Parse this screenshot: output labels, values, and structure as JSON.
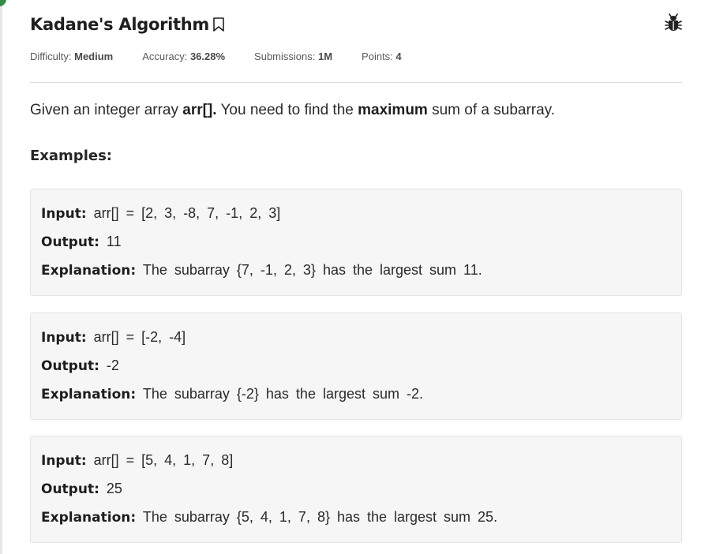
{
  "problem": {
    "title": "Kadane's Algorithm",
    "bookmark_icon": "bookmark-icon",
    "report_icon": "bug-icon"
  },
  "meta": {
    "difficulty_label": "Difficulty:",
    "difficulty_value": "Medium",
    "accuracy_label": "Accuracy:",
    "accuracy_value": "36.28%",
    "submissions_label": "Submissions:",
    "submissions_value": "1M",
    "points_label": "Points:",
    "points_value": "4"
  },
  "description": {
    "part1": "Given an integer array ",
    "part2": "arr[].",
    "part3": " You need to find the ",
    "part4": "maximum",
    "part5": " sum of a subarray."
  },
  "examples_heading": "Examples:",
  "labels": {
    "input": "Input:",
    "output": "Output:",
    "explanation": "Explanation:"
  },
  "examples": [
    {
      "input": " arr[] = [2, 3, -8, 7, -1, 2, 3]",
      "output": " 11",
      "explanation": " The subarray {7, -1, 2, 3} has the largest sum 11."
    },
    {
      "input": " arr[] = [-2, -4]",
      "output": " -2",
      "explanation": " The subarray {-2} has the largest sum -2."
    },
    {
      "input": " arr[] = [5, 4, 1, 7, 8]",
      "output": " 25",
      "explanation": " The subarray {5, 4, 1, 7, 8} has the largest sum 25."
    }
  ],
  "colors": {
    "accent": "#2f8d46",
    "example_bg": "#f6f6f6"
  }
}
